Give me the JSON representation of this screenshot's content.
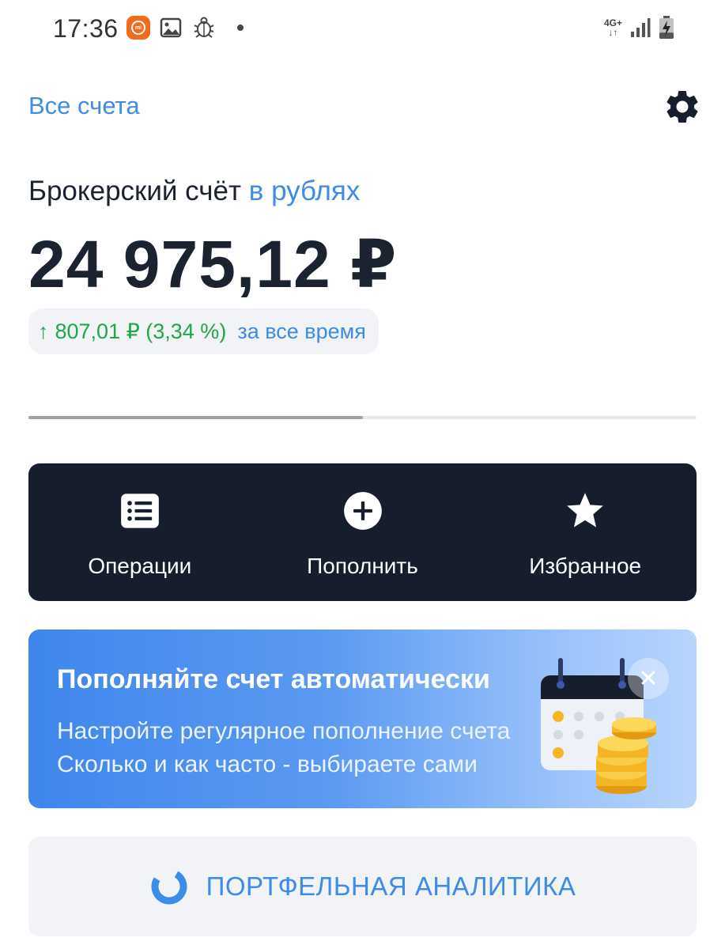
{
  "status_bar": {
    "time": "17:36",
    "network": "4G+",
    "battery_level": 0.3
  },
  "header": {
    "all_accounts": "Все счета",
    "settings_icon": "gear-icon"
  },
  "account": {
    "title": "Брокерский счёт",
    "currency": "в рублях",
    "balance": "24 975,12 ₽",
    "change_arrow": "↑",
    "change_value": "807,01 ₽ (3,34 %)",
    "change_period": "за все время"
  },
  "pager": {
    "active_fraction": 0.5
  },
  "actions": [
    {
      "label": "Операции",
      "icon": "list-icon"
    },
    {
      "label": "Пополнить",
      "icon": "plus-circle-icon"
    },
    {
      "label": "Избранное",
      "icon": "star-icon"
    }
  ],
  "promo": {
    "title": "Пополняйте счет автоматически",
    "line1": "Настройте регулярное пополнение счета",
    "line2": "Сколько и как часто - выбираете сами",
    "close": "✕"
  },
  "analytics": {
    "label": "ПОРТФЕЛЬНАЯ АНАЛИТИКА",
    "icon": "donut-chart-icon"
  },
  "colors": {
    "accent": "#3f8be8",
    "positive": "#22a64a",
    "panel_dark": "#161e2d",
    "text": "#1b2331"
  }
}
